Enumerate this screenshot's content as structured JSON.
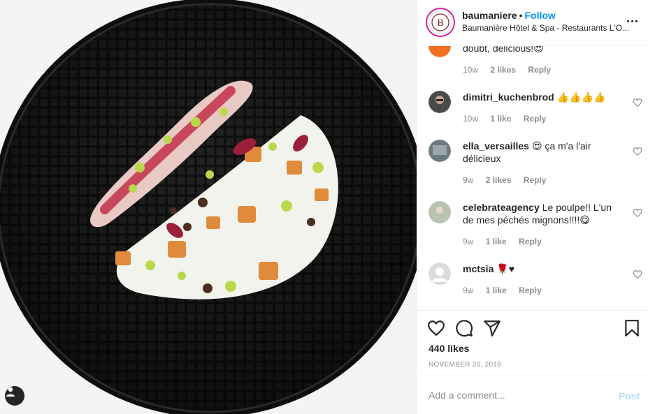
{
  "post": {
    "photo_alt": "",
    "tag_icon": "user-tag-icon"
  },
  "header": {
    "avatar_letter": "B",
    "username": "baumaniere",
    "separator": "•",
    "follow_label": "Follow",
    "location": "Baumanière Hôtel & Spa - Restaurants L'O..."
  },
  "comments": [
    {
      "username": "",
      "text": "doubt, delicious!😍",
      "time": "10w",
      "likes": "2 likes",
      "reply": "Reply",
      "avatar_color": "#f26f21"
    },
    {
      "username": "dimitri_kuchenbrod",
      "text": "👍👍👍👍",
      "time": "10w",
      "likes": "1 like",
      "reply": "Reply",
      "avatar_color": "#4a4a4a"
    },
    {
      "username": "ella_versailles",
      "text": "😍 ça m'a l'air délicieux",
      "time": "9w",
      "likes": "2 likes",
      "reply": "Reply",
      "avatar_color": "#6c7a80"
    },
    {
      "username": "celebrateagency",
      "text": "Le poulpe!! L'un de mes péchés mignons!!!!😋",
      "time": "9w",
      "likes": "1 like",
      "reply": "Reply",
      "avatar_color": "#b9c3b0"
    },
    {
      "username": "mctsia",
      "text": "🌹♥",
      "time": "9w",
      "likes": "1 like",
      "reply": "Reply",
      "avatar_color": "#dbdbdb"
    }
  ],
  "actions": {
    "likes": "440 likes",
    "date": "NOVEMBER 20, 2019",
    "icons": [
      "heart-icon",
      "comment-icon",
      "share-icon",
      "bookmark-icon"
    ]
  },
  "add_comment": {
    "placeholder": "Add a comment...",
    "post_label": "Post"
  },
  "colors": {
    "link_blue": "#0095f6",
    "post_disabled": "#b2dffc",
    "muted": "#8e8e8e",
    "ring": "#d6249f"
  }
}
